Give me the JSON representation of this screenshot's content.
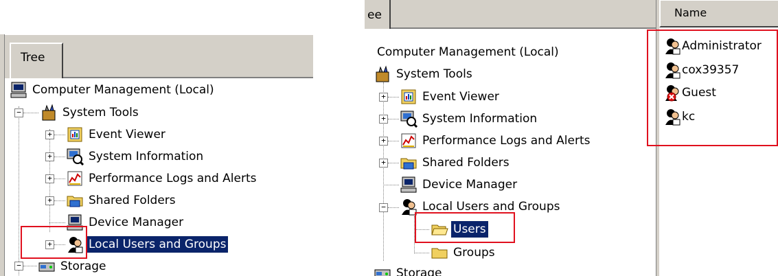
{
  "left": {
    "tab_label": "Tree",
    "items": [
      {
        "label": "Computer Management (Local)",
        "icon": "computer-icon"
      },
      {
        "label": "System Tools",
        "icon": "system-tools-icon",
        "expander": "−"
      },
      {
        "label": "Event Viewer",
        "icon": "event-viewer-icon",
        "expander": "+"
      },
      {
        "label": "System Information",
        "icon": "system-information-icon",
        "expander": "+"
      },
      {
        "label": "Performance Logs and Alerts",
        "icon": "performance-logs-icon",
        "expander": "+"
      },
      {
        "label": "Shared Folders",
        "icon": "shared-folders-icon",
        "expander": "+"
      },
      {
        "label": "Device Manager",
        "icon": "device-manager-icon"
      },
      {
        "label": "Local Users and Groups",
        "icon": "local-users-icon",
        "expander": "+"
      },
      {
        "label": "Storage",
        "icon": "storage-icon",
        "expander": "−"
      }
    ]
  },
  "right": {
    "tab_label": "ee",
    "items": [
      {
        "label": "Computer Management (Local)"
      },
      {
        "label": "System Tools",
        "icon": "system-tools-icon"
      },
      {
        "label": "Event Viewer",
        "icon": "event-viewer-icon",
        "expander": "+"
      },
      {
        "label": "System Information",
        "icon": "system-information-icon",
        "expander": "+"
      },
      {
        "label": "Performance Logs and Alerts",
        "icon": "performance-logs-icon",
        "expander": "+"
      },
      {
        "label": "Shared Folders",
        "icon": "shared-folders-icon",
        "expander": "+"
      },
      {
        "label": "Device Manager",
        "icon": "device-manager-icon"
      },
      {
        "label": "Local Users and Groups",
        "icon": "local-users-icon",
        "expander": "−"
      },
      {
        "label": "Users",
        "icon": "folder-open-icon"
      },
      {
        "label": "Groups",
        "icon": "folder-icon"
      },
      {
        "label": "Storage",
        "icon": "storage-icon"
      }
    ],
    "list_header": "Name",
    "users": [
      {
        "label": "Administrator",
        "icon": "user-icon"
      },
      {
        "label": "cox39357",
        "icon": "user-icon"
      },
      {
        "label": "Guest",
        "icon": "disabled-user-icon"
      },
      {
        "label": "kc",
        "icon": "user-icon"
      }
    ]
  },
  "colors": {
    "selection": "#0a246a",
    "highlight_box": "#e0101e",
    "chrome": "#d4d0c8"
  }
}
